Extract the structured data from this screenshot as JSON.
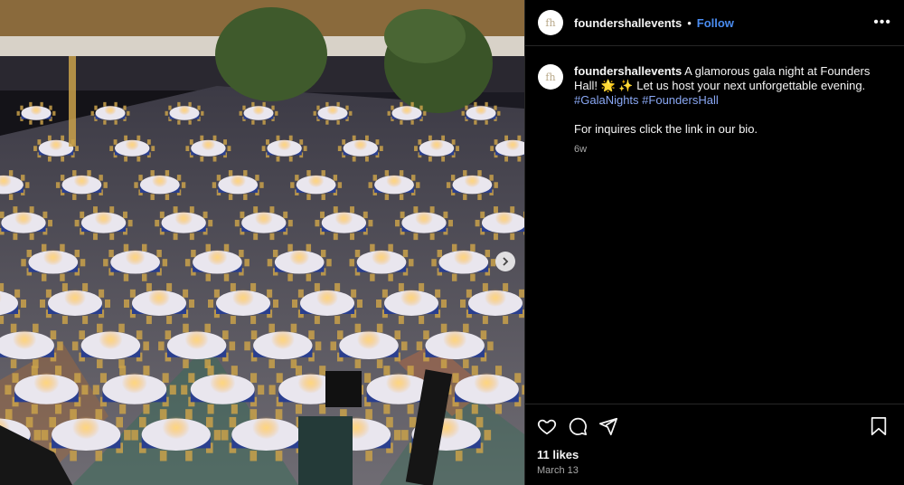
{
  "post": {
    "photo_alt": "gala banquet hall",
    "next_icon": "chevron-right-icon"
  },
  "header": {
    "avatar_text": "fh",
    "username": "foundershallevents",
    "separator": "•",
    "follow_label": "Follow",
    "more_label": "•••"
  },
  "caption": {
    "avatar_text": "fh",
    "username": "foundershallevents",
    "text_1": " A glamorous gala night at Founders Hall! 🌟 ✨ Let us host your next unforgettable evening. ",
    "hashtag_1": "#GalaNights",
    "hashtag_2": "#FoundersHall",
    "inquiry": "For inquires click the link in our bio.",
    "age": "6w"
  },
  "actions": {
    "icons": [
      "heart-icon",
      "comment-icon",
      "share-icon",
      "bookmark-icon"
    ],
    "likes": "11 likes",
    "date": "March 13"
  },
  "colors": {
    "background": "#000000",
    "follow": "#4a8cf0",
    "hashtag": "#8aa8f5",
    "tablecloth": "#2a3f8f",
    "gold": "#c9a14a"
  }
}
